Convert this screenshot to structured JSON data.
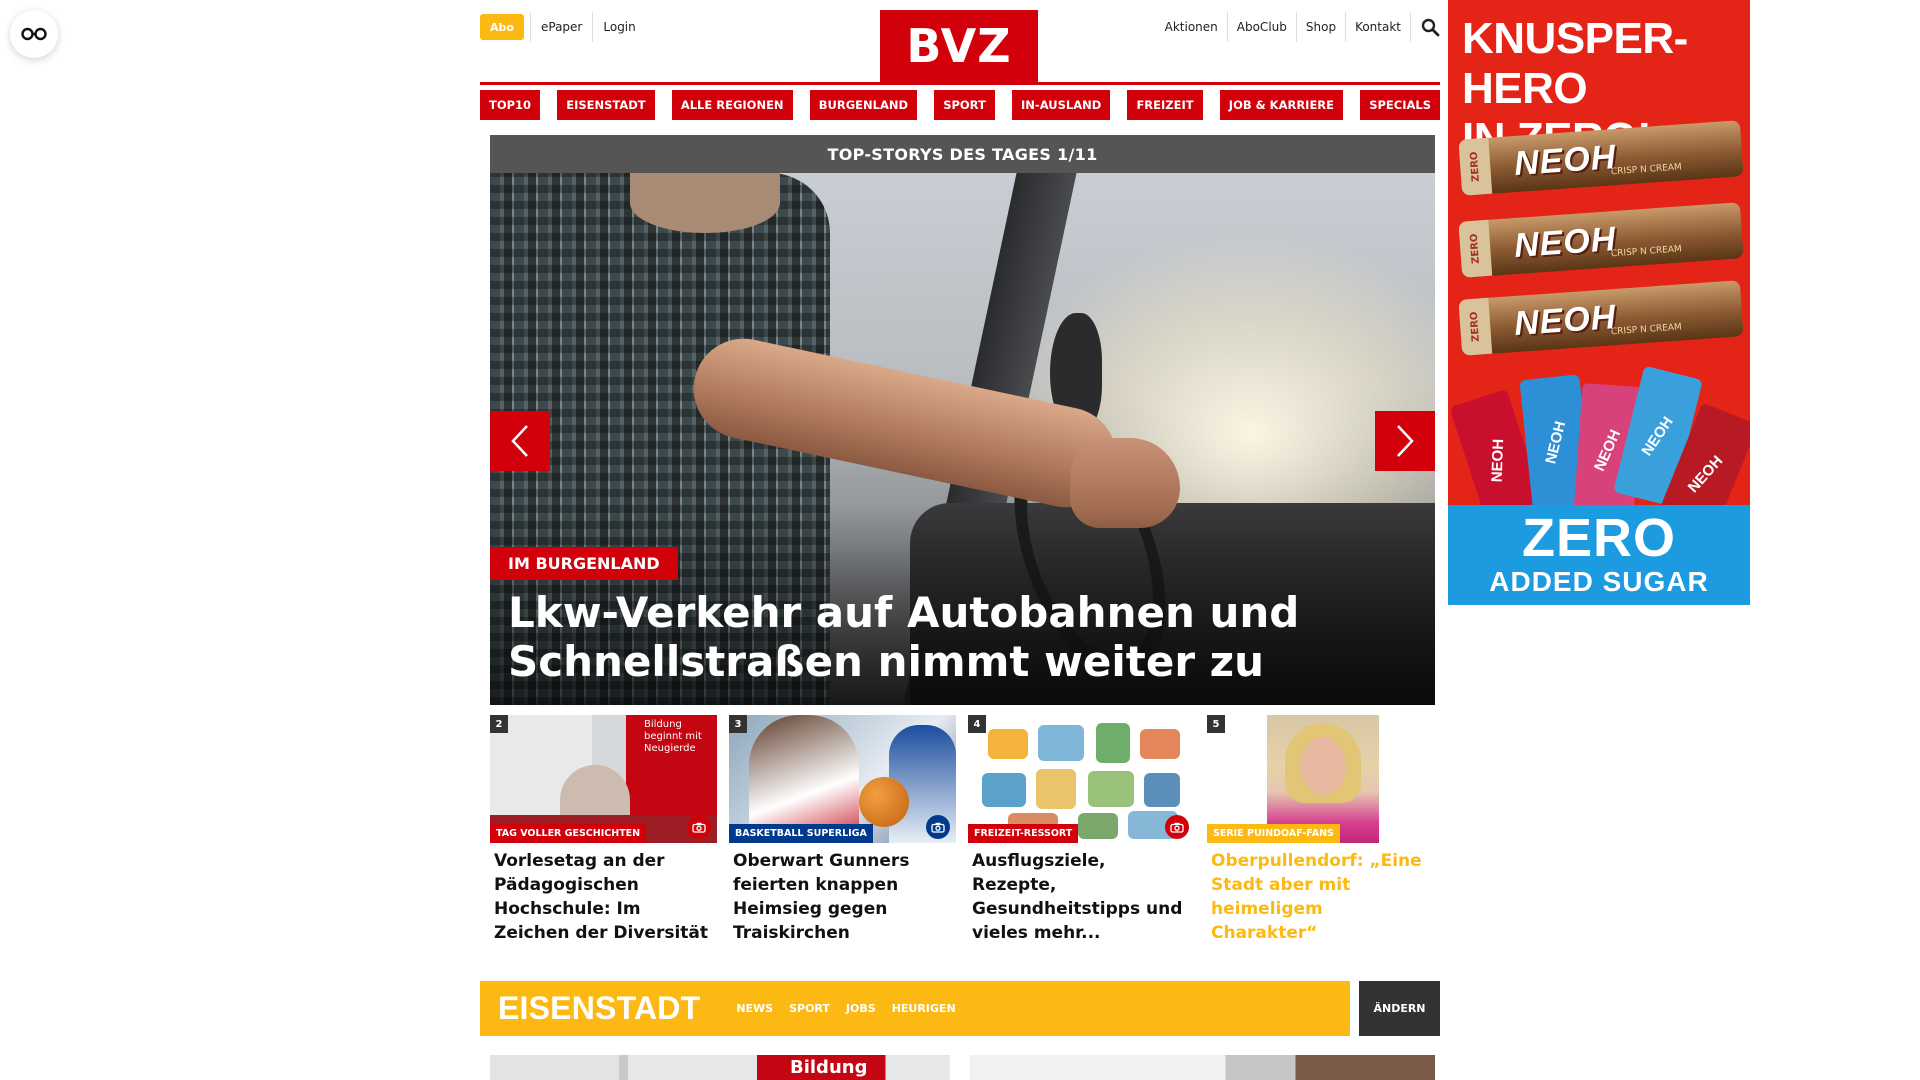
{
  "header": {
    "abo_label": "Abo",
    "left_links": [
      "ePaper",
      "Login"
    ],
    "logo_text": "BVZ",
    "right_links": [
      "Aktionen",
      "AboClub",
      "Shop",
      "Kontakt"
    ],
    "brand_color": "#d1000a",
    "accent_color": "#fdb913"
  },
  "nav": {
    "items": [
      "TOP10",
      "EISENSTADT",
      "ALLE REGIONEN",
      "BURGENLAND",
      "SPORT",
      "IN-AUSLAND",
      "FREIZEIT",
      "JOB & KARRIERE",
      "SPECIALS"
    ]
  },
  "slider": {
    "heading": "TOP-STORYS DES TAGES 1/11",
    "tag": "IM BURGENLAND",
    "title": "Lkw-Verkehr auf Autobahnen und Schnellstraßen nimmt weiter zu"
  },
  "teasers": [
    {
      "num": "2",
      "tag": "TAG VOLLER GESCHICHTEN",
      "tag_color": "#d1000a",
      "sign_text": "Bildung beginnt mit Neugierde",
      "title": "Vorlesetag an der Pädagogischen Hochschule: Im Zeichen der Diversität"
    },
    {
      "num": "3",
      "tag": "BASKETBALL SUPERLIGA",
      "tag_color": "#003a8c",
      "title": "Oberwart Gunners feierten knappen Heimsieg gegen Traiskirchen"
    },
    {
      "num": "4",
      "tag": "FREIZEIT-RESSORT",
      "tag_color": "#d1000a",
      "title": "Ausflugsziele, Rezepte, Gesundheitstipps und vieles mehr..."
    },
    {
      "num": "5",
      "tag": "SERIE PUINDOAF-FANS",
      "tag_color": "#fdb913",
      "title": "Oberpullendorf: „Eine Stadt aber mit heimeligem Charakter“"
    }
  ],
  "region": {
    "name": "EISENSTADT",
    "links": [
      "NEWS",
      "SPORT",
      "JOBS",
      "HEURIGEN"
    ],
    "change_label": "ÄNDERN",
    "image_text": "Bildung"
  },
  "ad": {
    "headline_line1": "KNUSPER-HERO",
    "headline_line2": "IN ZERO!",
    "bar_brand": "NEOH",
    "bar_sub": "CRISP N CREAM",
    "bar_zero": "ZERO",
    "pack_labels": [
      "NEOH",
      "NEOH",
      "NEOH",
      "NEOH",
      "NEOH"
    ],
    "bottom_line1": "ZERO",
    "bottom_line2": "ADDED SUGAR"
  }
}
